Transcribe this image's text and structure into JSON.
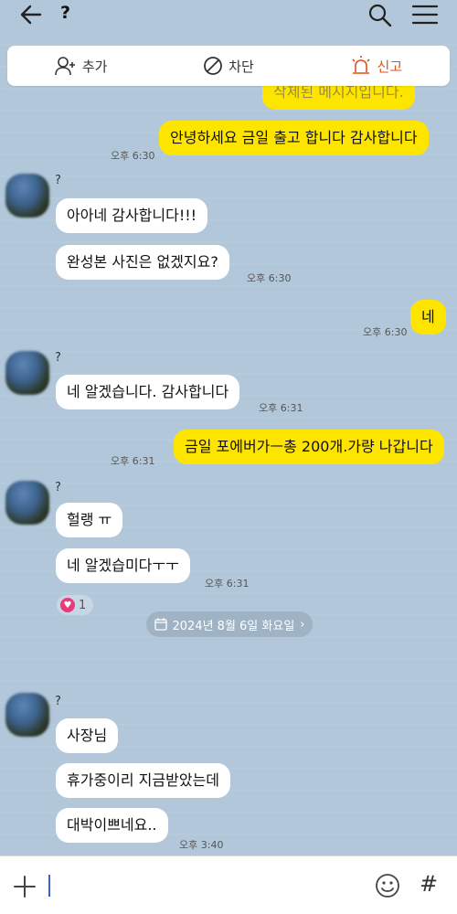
{
  "header": {
    "title": "?"
  },
  "actions": {
    "add": "추가",
    "block": "차단",
    "report": "신고"
  },
  "messages": {
    "deleted": "삭제된 메시지입니다.",
    "m1": "안녕하세요 금일 출고 합니다 감사합니다",
    "m1_time": "오후 6:30",
    "g1_sender": "?",
    "m2": "아아네 감사합니다!!!",
    "m3": "완성본 사진은 없겠지요?",
    "m3_time": "오후 6:30",
    "m4": "네",
    "m4_time": "오후 6:30",
    "g2_sender": "?",
    "m5": "네 알겠습니다. 감사합니다",
    "m5_time": "오후 6:31",
    "m6": "금일 포에버가ㅡ총 200개.가량 나갑니다",
    "m6_time": "오후 6:31",
    "g3_sender": "?",
    "m7": "헐랭 ㅠ",
    "m8": "네 알겠습미다ㅜㅜ",
    "m8_time": "오후 6:31",
    "reaction_count": "1",
    "date_divider": "2024년 8월 6일 화요일",
    "g4_sender": "?",
    "m9": "사장님",
    "m10": "휴가중이리 지금받았는데",
    "m11": "대박이쁘네요..",
    "m11_time": "오후 3:40"
  },
  "colors": {
    "background": "#b2c7d9",
    "outgoing_bubble": "#fee500",
    "incoming_bubble": "#ffffff",
    "report_accent": "#d9531e"
  }
}
